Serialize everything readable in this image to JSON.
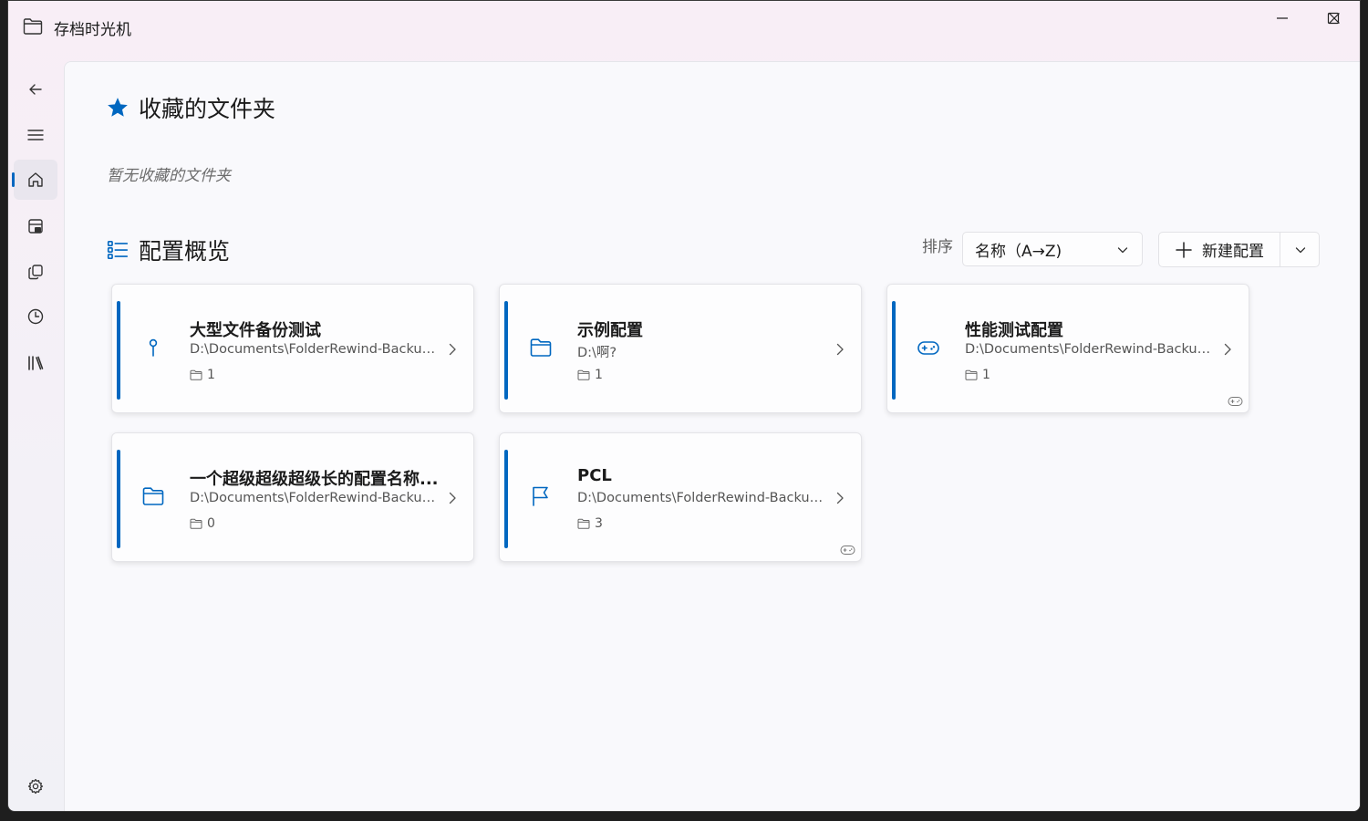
{
  "app": {
    "title": "存档时光机"
  },
  "favorites": {
    "title": "收藏的文件夹",
    "empty_text": "暂无收藏的文件夹"
  },
  "overview": {
    "title": "配置概览",
    "sort_label": "排序",
    "sort_value": "名称（A→Z)",
    "new_button_label": "新建配置"
  },
  "configs": [
    {
      "name": "大型文件备份测试",
      "path": "D:\\Documents\\FolderRewind-Backup\\...",
      "folder_count": "1",
      "icon": "pin-icon",
      "game": false
    },
    {
      "name": "示例配置",
      "path": "D:\\啊?",
      "folder_count": "1",
      "icon": "folder-icon",
      "game": false
    },
    {
      "name": "性能测试配置",
      "path": "D:\\Documents\\FolderRewind-Backup\\...",
      "folder_count": "1",
      "icon": "gamepad-icon",
      "game": true
    },
    {
      "name": "一个超级超级超级长的配置名称...",
      "path": "D:\\Documents\\FolderRewind-Backup\\...",
      "folder_count": "0",
      "icon": "folder-icon",
      "game": false
    },
    {
      "name": "PCL",
      "path": "D:\\Documents\\FolderRewind-Backup\\...",
      "folder_count": "3",
      "icon": "flag-icon",
      "game": true
    }
  ],
  "colors": {
    "accent": "#0067c0",
    "bg": "#f9f9fc"
  }
}
